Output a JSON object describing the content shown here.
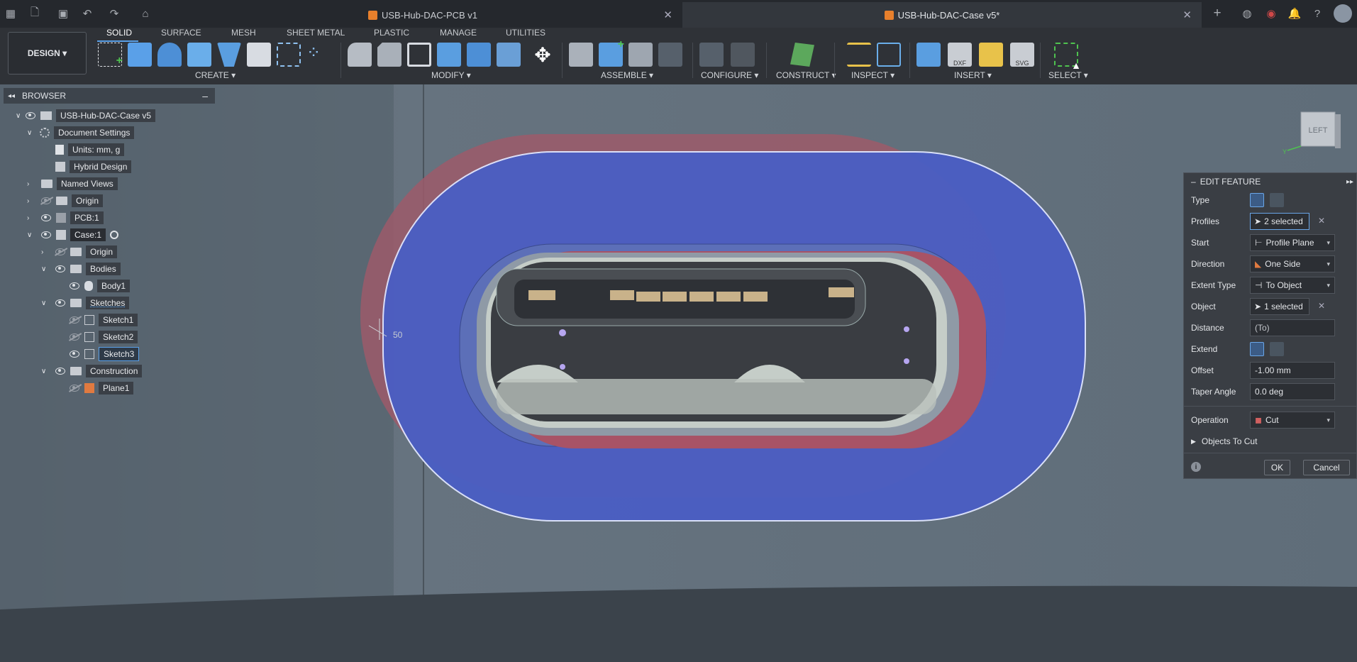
{
  "tabs": [
    {
      "label": "USB-Hub-DAC-PCB v1"
    },
    {
      "label": "USB-Hub-DAC-Case v5*"
    }
  ],
  "toolbar": {
    "design_label": "DESIGN",
    "workspace_tabs": [
      "SOLID",
      "SURFACE",
      "MESH",
      "SHEET METAL",
      "PLASTIC",
      "MANAGE",
      "UTILITIES"
    ],
    "groups": [
      "CREATE",
      "MODIFY",
      "ASSEMBLE",
      "CONFIGURE",
      "CONSTRUCT",
      "INSPECT",
      "INSERT",
      "SELECT"
    ]
  },
  "browser": {
    "title": "BROWSER",
    "items": [
      {
        "label": "USB-Hub-DAC-Case v5"
      },
      {
        "label": "Document Settings"
      },
      {
        "label": "Units: mm, g"
      },
      {
        "label": "Hybrid Design"
      },
      {
        "label": "Named Views"
      },
      {
        "label": "Origin"
      },
      {
        "label": "PCB:1"
      },
      {
        "label": "Case:1"
      },
      {
        "label": "Origin"
      },
      {
        "label": "Bodies"
      },
      {
        "label": "Body1"
      },
      {
        "label": "Sketches"
      },
      {
        "label": "Sketch1"
      },
      {
        "label": "Sketch2"
      },
      {
        "label": "Sketch3"
      },
      {
        "label": "Construction"
      },
      {
        "label": "Plane1"
      }
    ]
  },
  "viewcube": {
    "face_label": "LEFT"
  },
  "viewport": {
    "dimension_label": "50"
  },
  "edit_feature": {
    "title": "EDIT FEATURE",
    "rows": {
      "type_label": "Type",
      "profiles_label": "Profiles",
      "profiles_value": "2 selected",
      "start_label": "Start",
      "start_value": "Profile Plane",
      "direction_label": "Direction",
      "direction_value": "One Side",
      "extent_label": "Extent Type",
      "extent_value": "To Object",
      "object_label": "Object",
      "object_value": "1 selected",
      "distance_label": "Distance",
      "distance_value": "(To)",
      "extend_label": "Extend",
      "offset_label": "Offset",
      "offset_value": "-1.00 mm",
      "taper_label": "Taper Angle",
      "taper_value": "0.0 deg",
      "operation_label": "Operation",
      "operation_value": "Cut",
      "objects_to_cut_label": "Objects To Cut"
    },
    "ok_label": "OK",
    "cancel_label": "Cancel"
  }
}
